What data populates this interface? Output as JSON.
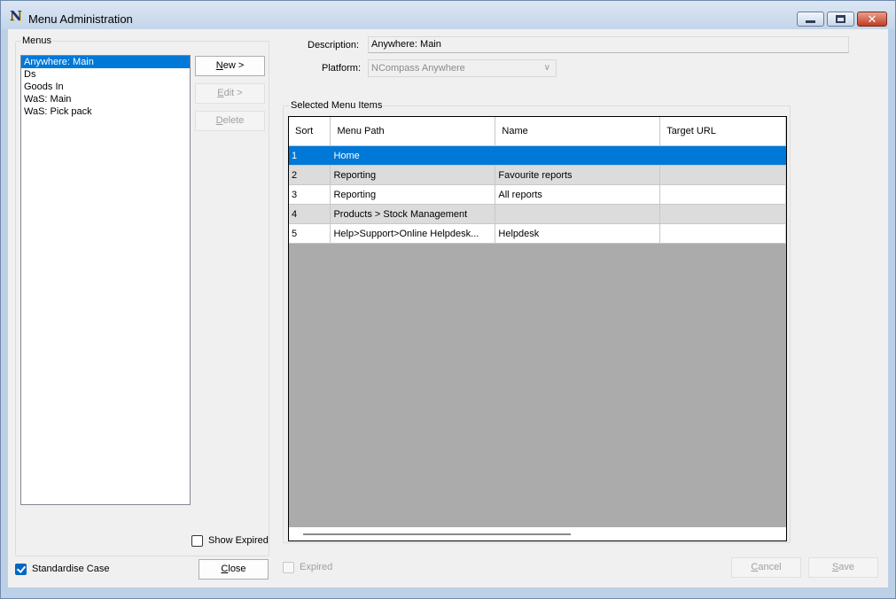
{
  "window": {
    "title": "Menu Administration",
    "close_glyph": "✕"
  },
  "menus_panel": {
    "label": "Menus",
    "items": [
      "Anywhere: Main",
      "Ds",
      "Goods In",
      "WaS: Main",
      "WaS: Pick pack"
    ],
    "selected_index": 0,
    "new_prefix": "",
    "new_hotkey": "N",
    "new_suffix": "ew >",
    "edit_prefix": "",
    "edit_hotkey": "E",
    "edit_suffix": "dit >",
    "delete_prefix": "",
    "delete_hotkey": "D",
    "delete_suffix": "elete",
    "show_expired_label": "Show Expired",
    "show_expired_checked": false
  },
  "footer": {
    "standardise_case_label": "Standardise Case",
    "standardise_case_checked": true,
    "close_prefix": "",
    "close_hotkey": "C",
    "close_suffix": "lose",
    "expired_label": "Expired",
    "cancel_prefix": "",
    "cancel_hotkey": "C",
    "cancel_suffix": "ancel",
    "save_prefix": "",
    "save_hotkey": "S",
    "save_suffix": "ave"
  },
  "details": {
    "description_label": "Description:",
    "description_value": "Anywhere: Main",
    "platform_label": "Platform:",
    "platform_value": "NCompass Anywhere",
    "chevron_glyph": "∨"
  },
  "selected_items": {
    "label": "Selected Menu Items",
    "columns": [
      "Sort",
      "Menu Path",
      "Name",
      "Target URL"
    ],
    "rows": [
      {
        "sort": "1",
        "path": "Home",
        "name": "",
        "url": ""
      },
      {
        "sort": "2",
        "path": "Reporting",
        "name": "Favourite reports",
        "url": ""
      },
      {
        "sort": "3",
        "path": "Reporting",
        "name": "All reports",
        "url": ""
      },
      {
        "sort": "4",
        "path": "Products > Stock Management",
        "name": "",
        "url": ""
      },
      {
        "sort": "5",
        "path": "Help>Support>Online Helpdesk...",
        "name": "Helpdesk",
        "url": ""
      }
    ],
    "selected_row": 0
  }
}
